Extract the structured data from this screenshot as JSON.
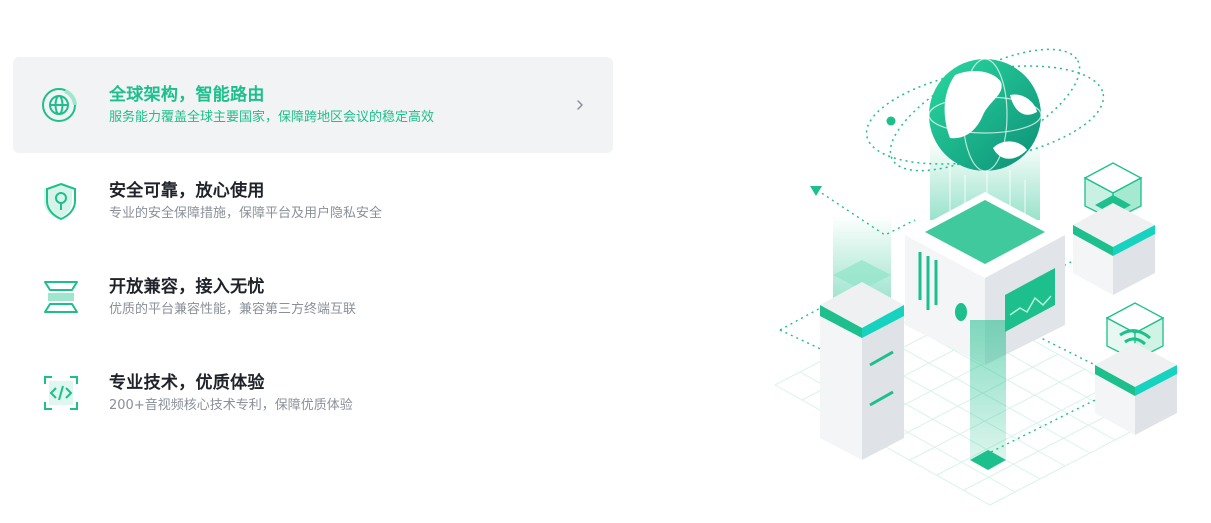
{
  "features": [
    {
      "title": "全球架构，智能路由",
      "desc": "服务能力覆盖全球主要国家，保障跨地区会议的稳定高效",
      "icon": "globe-icon",
      "active": true
    },
    {
      "title": "安全可靠，放心使用",
      "desc": "专业的安全保障措施，保障平台及用户隐私安全",
      "icon": "shield-key-icon",
      "active": false
    },
    {
      "title": "开放兼容，接入无忧",
      "desc": "优质的平台兼容性能，兼容第三方终端互联",
      "icon": "layers-icon",
      "active": false
    },
    {
      "title": "专业技术，优质体验",
      "desc": "200+音视频核心技术专利，保障优质体验",
      "icon": "code-icon",
      "active": false
    }
  ],
  "colors": {
    "accent": "#1dbf8c",
    "title": "#1f2329",
    "desc": "#8a8f99",
    "active_bg": "#f2f3f5"
  }
}
